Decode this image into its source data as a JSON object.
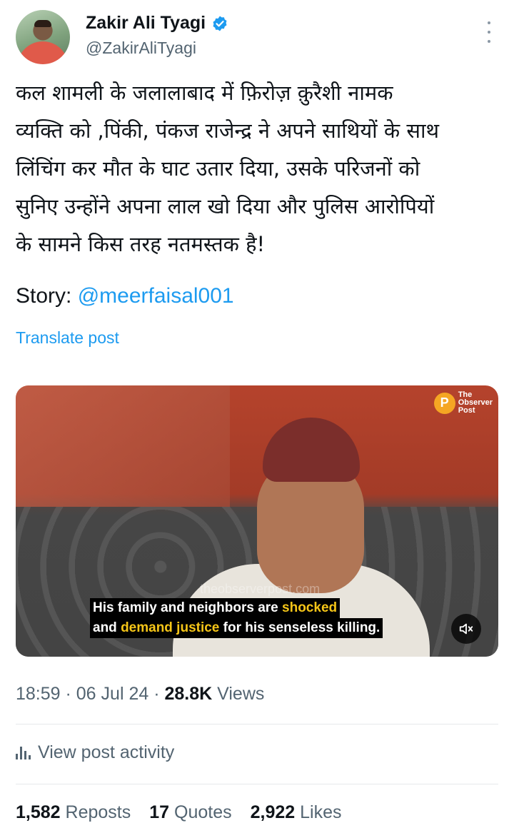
{
  "author": {
    "name": "Zakir Ali Tyagi",
    "handle": "@ZakirAliTyagi",
    "verified_color": "#1d9bf0"
  },
  "tweet": {
    "text_lines": [
      "कल शामली के जलालाबाद में फ़िरोज़ क़ुरैशी नामक",
      "व्यक्ति को ,पिंकी, पंकज राजेन्द्र ने अपने साथियों के साथ",
      "लिंचिंग कर मौत के घाट उतार दिया, उसके परिजनों को",
      "सुनिए उन्होंने अपना लाल खो दिया और पुलिस आरोपियों",
      "के सामने किस तरह नतमस्तक है!"
    ],
    "story_label": "Story: ",
    "story_mention": "@meerfaisal001",
    "translate_label": "Translate post"
  },
  "media": {
    "logo_mark": "P",
    "logo_lines": [
      "The",
      "Observer",
      "Post"
    ],
    "watermark": "theobserverpost.com",
    "caption_line1_pre": "His family and neighbors are ",
    "caption_line1_hl": "shocked",
    "caption_line2_pre": "and ",
    "caption_line2_hl": "demand justice",
    "caption_line2_post": " for his senseless killing.",
    "mute_icon": "speaker-muted-icon"
  },
  "meta": {
    "time": "18:59",
    "date": "06 Jul 24",
    "views_count": "28.8K",
    "views_label": "Views"
  },
  "activity": {
    "label": "View post activity"
  },
  "stats": {
    "reposts_count": "1,582",
    "reposts_label": "Reposts",
    "quotes_count": "17",
    "quotes_label": "Quotes",
    "likes_count": "2,922",
    "likes_label": "Likes"
  },
  "colors": {
    "text": "#0f1419",
    "secondary": "#536471",
    "link": "#1d9bf0",
    "caption_highlight": "#f5c518"
  }
}
